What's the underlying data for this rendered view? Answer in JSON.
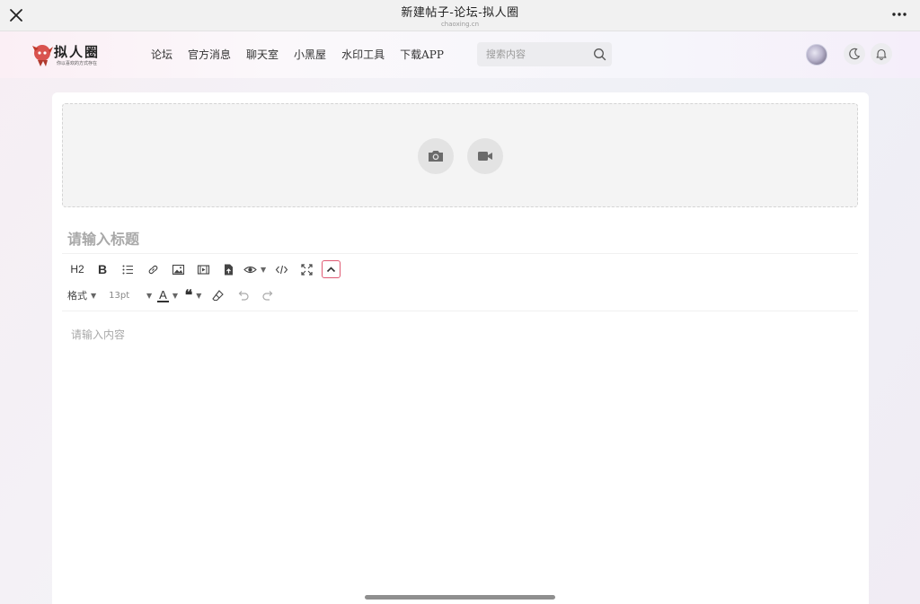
{
  "browser": {
    "title": "新建帖子-论坛-拟人圈",
    "domain": "chaoxing.cn"
  },
  "site": {
    "logo_text": "拟人圈",
    "logo_sub": "你以喜欢的方式存在"
  },
  "nav": {
    "items": [
      {
        "label": "论坛"
      },
      {
        "label": "官方消息"
      },
      {
        "label": "聊天室"
      },
      {
        "label": "小黑屋"
      },
      {
        "label": "水印工具"
      },
      {
        "label": "下载APP"
      }
    ]
  },
  "search": {
    "placeholder": "搜索内容",
    "value": ""
  },
  "editor": {
    "title_placeholder": "请输入标题",
    "title_value": "",
    "content_placeholder": "请输入内容",
    "content_value": "",
    "toolbar": {
      "heading_label": "H2",
      "bold_label": "B",
      "format_label": "格式",
      "font_size": "13pt",
      "color_label": "A",
      "quote_label": "❝"
    }
  },
  "colors": {
    "accent": "#e05a73",
    "card": "#ffffff",
    "upload_zone": "#f4f4f4"
  },
  "icons": {
    "close": "close-icon",
    "more": "more-icon",
    "search": "search-icon",
    "theme": "moon-icon",
    "notifications": "bell-icon",
    "photo": "camera-icon",
    "video": "video-camera-icon"
  }
}
